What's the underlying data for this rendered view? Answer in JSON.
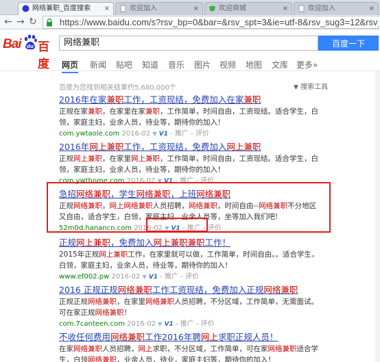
{
  "browser": {
    "tabs": [
      {
        "label": "网络兼职_百度搜索",
        "active": true
      },
      {
        "label": "欢迎加入",
        "active": false
      },
      {
        "label": "欢迎商城",
        "active": false
      },
      {
        "label": "欢迎加入",
        "active": false
      },
      {
        "label": "欢迎加入",
        "active": false
      }
    ],
    "url": "https://www.baidu.com/s?rsv_bp=0&bar=&rsv_spt=3&ie=utf-8&rsv_sug3=12&rsv_sug"
  },
  "header": {
    "logo_text_bai": "Bai",
    "logo_text_du": "百度",
    "search_value": "网络兼职",
    "search_button": "百度一下"
  },
  "nav": {
    "tabs": [
      "网页",
      "新闻",
      "贴吧",
      "知道",
      "音乐",
      "图片",
      "视频",
      "地图",
      "文库",
      "更多»"
    ]
  },
  "stats": "百度为您找到相关结果约5,680,000个",
  "tools": "搜索工具",
  "results": [
    {
      "title_parts": [
        [
          "2016年在家",
          0
        ],
        [
          "兼职",
          1
        ],
        [
          "工作，工资现结，免费加入在家",
          0
        ],
        [
          "兼职",
          1
        ]
      ],
      "abstract_parts": [
        [
          "正规在家",
          0
        ],
        [
          "兼职",
          1
        ],
        [
          "，在家里在家",
          0
        ],
        [
          "兼职",
          1
        ],
        [
          "，工作简单，时间自由，工资现结。适合学生，白领，家庭主妇，业余人员，待业等，期待你的加入！",
          0
        ]
      ],
      "url": "com.ywtaole.com",
      "date": "2016-02",
      "v1": "V1",
      "extra": "- 推广 - 评价"
    },
    {
      "title_parts": [
        [
          "2016年",
          0
        ],
        [
          "网上兼职",
          1
        ],
        [
          "工作，工资现结，免费加入",
          0
        ],
        [
          "网上兼职",
          1
        ]
      ],
      "abstract_parts": [
        [
          "正规",
          0
        ],
        [
          "网上兼职",
          1
        ],
        [
          "，在家里",
          0
        ],
        [
          "网上兼职",
          1
        ],
        [
          "，工作简单，时间自由，工资现结。适合学生，白领，家庭主妇，业余人员，待业等，期待你的加入！",
          0
        ]
      ],
      "url": "com.ywthome.com",
      "date": "2016-02",
      "v1": "V1",
      "extra": "- 推广 - 评价"
    },
    {
      "title_parts": [
        [
          "急招",
          0
        ],
        [
          "网络兼职",
          1
        ],
        [
          "，学生",
          0
        ],
        [
          "网络兼职",
          1
        ],
        [
          "，上班",
          0
        ],
        [
          "网络兼职",
          1
        ]
      ],
      "abstract_parts": [
        [
          "正规",
          0
        ],
        [
          "网络兼职",
          1
        ],
        [
          "，",
          0
        ],
        [
          "网上",
          1
        ],
        [
          "网络兼职",
          1
        ],
        [
          "人员招聘，",
          0
        ],
        [
          "网络兼职",
          1
        ],
        [
          "，时间自由--",
          0
        ],
        [
          "网络兼职",
          1
        ],
        [
          "不分地区又自由，适合学生，白领，家庭主妇，业余人员等，坐等加入我们吧!",
          0
        ]
      ],
      "url": "52m0d.hanancn.com",
      "date": "2016-02",
      "v1": "V1",
      "extra": "- 推广 - 评价"
    },
    {
      "title_parts": [
        [
          "正规",
          0
        ],
        [
          "网上兼职",
          1
        ],
        [
          "，免费加入",
          0
        ],
        [
          "网上兼职兼职",
          1
        ],
        [
          "工作！",
          0
        ]
      ],
      "abstract_parts": [
        [
          "2015年正规",
          0
        ],
        [
          "网上兼职",
          1
        ],
        [
          "工作，在家里就可以做，工作简单，时间自由。。适合学生，白领，家庭主妇，业余人员，待业等，期待你的加入！",
          0
        ]
      ],
      "url": "www.ef002.pw",
      "date": "2016-02",
      "v1": "V1",
      "extra": "- 推广 - 评价"
    },
    {
      "title_parts": [
        [
          "2016 正规正规",
          0
        ],
        [
          "网络兼职",
          1
        ],
        [
          "工作工资现结，免费加入正规",
          0
        ],
        [
          "网络兼职",
          1
        ]
      ],
      "abstract_parts": [
        [
          "正规正规",
          0
        ],
        [
          "网络兼职",
          1
        ],
        [
          "，在家里",
          0
        ],
        [
          "网络兼职",
          1
        ],
        [
          "人员招聘，不分区域，工作简单，无需面试。可在家正规",
          0
        ],
        [
          "网络兼职",
          1
        ],
        [
          "！",
          0
        ]
      ],
      "url": "com.7canteen.com",
      "date": "2016-02",
      "v1": "V1",
      "extra": "- 推广 - 评价"
    },
    {
      "title_parts": [
        [
          "不收任何费用",
          0
        ],
        [
          "网络兼职",
          1
        ],
        [
          "工作2016年聘",
          0
        ],
        [
          "网上",
          1
        ],
        [
          "求职正规人员！",
          0
        ]
      ],
      "abstract_parts": [
        [
          "在家",
          0
        ],
        [
          "网络兼职",
          1
        ],
        [
          "人员招聘，",
          0
        ],
        [
          "网上",
          1
        ],
        [
          "求职，不分区域，工作简单，可在家",
          0
        ],
        [
          "网络兼职",
          1
        ],
        [
          "适合学生，白领",
          0
        ],
        [
          "网络兼职",
          1
        ],
        [
          "，业余人员，待业，家庭主妇等，期待你的加入！",
          0
        ]
      ],
      "url": "",
      "date": "",
      "v1": "",
      "extra": ""
    }
  ]
}
